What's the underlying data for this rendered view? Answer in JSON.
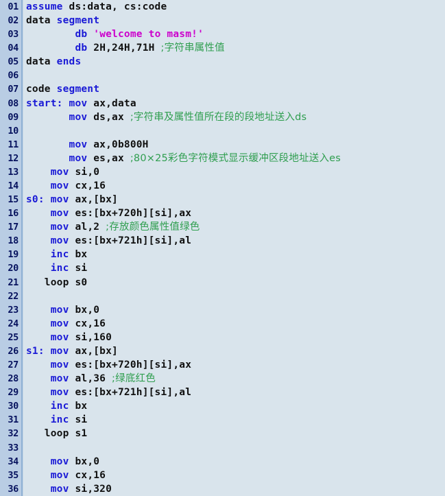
{
  "editor": {
    "name": "assembly-code-listing",
    "language": "masm-assembly",
    "background_color": "#d9e4ec",
    "gutter_color": "#b9cde4",
    "gutter_text_color": "#06125e",
    "keyword_color": "#1a1ad6",
    "text_color": "#101010",
    "string_color": "#cc00cc",
    "comment_color": "#2f9e4f",
    "first_line": 1,
    "last_line": 36,
    "total_lines": 36
  },
  "lines": [
    {
      "n": "01",
      "tokens": [
        {
          "c": "kw",
          "t": "assume"
        },
        {
          "c": "txt",
          "t": " ds:data, cs:code"
        }
      ]
    },
    {
      "n": "02",
      "tokens": [
        {
          "c": "txt",
          "t": "data "
        },
        {
          "c": "kw",
          "t": "segment"
        }
      ]
    },
    {
      "n": "03",
      "tokens": [
        {
          "c": "txt",
          "t": "        "
        },
        {
          "c": "kw",
          "t": "db"
        },
        {
          "c": "txt",
          "t": " "
        },
        {
          "c": "str",
          "t": "'welcome to masm!'"
        }
      ]
    },
    {
      "n": "04",
      "tokens": [
        {
          "c": "txt",
          "t": "        "
        },
        {
          "c": "kw",
          "t": "db"
        },
        {
          "c": "txt",
          "t": " 2H,24H,71H "
        },
        {
          "c": "cmt",
          "t": ";字符串属性值"
        }
      ]
    },
    {
      "n": "05",
      "tokens": [
        {
          "c": "txt",
          "t": "data "
        },
        {
          "c": "kw",
          "t": "ends"
        }
      ]
    },
    {
      "n": "06",
      "tokens": []
    },
    {
      "n": "07",
      "tokens": [
        {
          "c": "txt",
          "t": "code "
        },
        {
          "c": "kw",
          "t": "segment"
        }
      ]
    },
    {
      "n": "08",
      "tokens": [
        {
          "c": "kw",
          "t": "start:"
        },
        {
          "c": "txt",
          "t": " "
        },
        {
          "c": "kw",
          "t": "mov"
        },
        {
          "c": "txt",
          "t": " ax,data"
        }
      ]
    },
    {
      "n": "09",
      "tokens": [
        {
          "c": "txt",
          "t": "       "
        },
        {
          "c": "kw",
          "t": "mov"
        },
        {
          "c": "txt",
          "t": " ds,ax "
        },
        {
          "c": "cmt",
          "t": ";字符串及属性值所在段的段地址送入ds"
        }
      ]
    },
    {
      "n": "10",
      "tokens": []
    },
    {
      "n": "11",
      "tokens": [
        {
          "c": "txt",
          "t": "       "
        },
        {
          "c": "kw",
          "t": "mov"
        },
        {
          "c": "txt",
          "t": " ax,0b800H"
        }
      ]
    },
    {
      "n": "12",
      "tokens": [
        {
          "c": "txt",
          "t": "       "
        },
        {
          "c": "kw",
          "t": "mov"
        },
        {
          "c": "txt",
          "t": " es,ax "
        },
        {
          "c": "cmt",
          "t": ";80×25彩色字符模式显示缓冲区段地址送入es"
        }
      ]
    },
    {
      "n": "13",
      "tokens": [
        {
          "c": "txt",
          "t": "    "
        },
        {
          "c": "kw",
          "t": "mov"
        },
        {
          "c": "txt",
          "t": " si,0"
        }
      ]
    },
    {
      "n": "14",
      "tokens": [
        {
          "c": "txt",
          "t": "    "
        },
        {
          "c": "kw",
          "t": "mov"
        },
        {
          "c": "txt",
          "t": " cx,16"
        }
      ]
    },
    {
      "n": "15",
      "tokens": [
        {
          "c": "kw",
          "t": "s0:"
        },
        {
          "c": "txt",
          "t": " "
        },
        {
          "c": "kw",
          "t": "mov"
        },
        {
          "c": "txt",
          "t": " ax,[bx]"
        }
      ]
    },
    {
      "n": "16",
      "tokens": [
        {
          "c": "txt",
          "t": "    "
        },
        {
          "c": "kw",
          "t": "mov"
        },
        {
          "c": "txt",
          "t": " es:[bx+720h][si],ax"
        }
      ]
    },
    {
      "n": "17",
      "tokens": [
        {
          "c": "txt",
          "t": "    "
        },
        {
          "c": "kw",
          "t": "mov"
        },
        {
          "c": "txt",
          "t": " al,2 "
        },
        {
          "c": "cmt",
          "t": ";存放颜色属性值绿色"
        }
      ]
    },
    {
      "n": "18",
      "tokens": [
        {
          "c": "txt",
          "t": "    "
        },
        {
          "c": "kw",
          "t": "mov"
        },
        {
          "c": "txt",
          "t": " es:[bx+721h][si],al"
        }
      ]
    },
    {
      "n": "19",
      "tokens": [
        {
          "c": "txt",
          "t": "    "
        },
        {
          "c": "kw",
          "t": "inc"
        },
        {
          "c": "txt",
          "t": " bx"
        }
      ]
    },
    {
      "n": "20",
      "tokens": [
        {
          "c": "txt",
          "t": "    "
        },
        {
          "c": "kw",
          "t": "inc"
        },
        {
          "c": "txt",
          "t": " si"
        }
      ]
    },
    {
      "n": "21",
      "tokens": [
        {
          "c": "txt",
          "t": "   loop s0"
        }
      ]
    },
    {
      "n": "22",
      "tokens": []
    },
    {
      "n": "23",
      "tokens": [
        {
          "c": "txt",
          "t": "    "
        },
        {
          "c": "kw",
          "t": "mov"
        },
        {
          "c": "txt",
          "t": " bx,0"
        }
      ]
    },
    {
      "n": "24",
      "tokens": [
        {
          "c": "txt",
          "t": "    "
        },
        {
          "c": "kw",
          "t": "mov"
        },
        {
          "c": "txt",
          "t": " cx,16"
        }
      ]
    },
    {
      "n": "25",
      "tokens": [
        {
          "c": "txt",
          "t": "    "
        },
        {
          "c": "kw",
          "t": "mov"
        },
        {
          "c": "txt",
          "t": " si,160"
        }
      ]
    },
    {
      "n": "26",
      "tokens": [
        {
          "c": "kw",
          "t": "s1:"
        },
        {
          "c": "txt",
          "t": " "
        },
        {
          "c": "kw",
          "t": "mov"
        },
        {
          "c": "txt",
          "t": " ax,[bx]"
        }
      ]
    },
    {
      "n": "27",
      "tokens": [
        {
          "c": "txt",
          "t": "    "
        },
        {
          "c": "kw",
          "t": "mov"
        },
        {
          "c": "txt",
          "t": " es:[bx+720h][si],ax"
        }
      ]
    },
    {
      "n": "28",
      "tokens": [
        {
          "c": "txt",
          "t": "    "
        },
        {
          "c": "kw",
          "t": "mov"
        },
        {
          "c": "txt",
          "t": " al,36 "
        },
        {
          "c": "cmt",
          "t": ";绿底红色"
        }
      ]
    },
    {
      "n": "29",
      "tokens": [
        {
          "c": "txt",
          "t": "    "
        },
        {
          "c": "kw",
          "t": "mov"
        },
        {
          "c": "txt",
          "t": " es:[bx+721h][si],al"
        }
      ]
    },
    {
      "n": "30",
      "tokens": [
        {
          "c": "txt",
          "t": "    "
        },
        {
          "c": "kw",
          "t": "inc"
        },
        {
          "c": "txt",
          "t": " bx"
        }
      ]
    },
    {
      "n": "31",
      "tokens": [
        {
          "c": "txt",
          "t": "    "
        },
        {
          "c": "kw",
          "t": "inc"
        },
        {
          "c": "txt",
          "t": " si"
        }
      ]
    },
    {
      "n": "32",
      "tokens": [
        {
          "c": "txt",
          "t": "   loop s1"
        }
      ]
    },
    {
      "n": "33",
      "tokens": []
    },
    {
      "n": "34",
      "tokens": [
        {
          "c": "txt",
          "t": "    "
        },
        {
          "c": "kw",
          "t": "mov"
        },
        {
          "c": "txt",
          "t": " bx,0"
        }
      ]
    },
    {
      "n": "35",
      "tokens": [
        {
          "c": "txt",
          "t": "    "
        },
        {
          "c": "kw",
          "t": "mov"
        },
        {
          "c": "txt",
          "t": " cx,16"
        }
      ]
    },
    {
      "n": "36",
      "tokens": [
        {
          "c": "txt",
          "t": "    "
        },
        {
          "c": "kw",
          "t": "mov"
        },
        {
          "c": "txt",
          "t": " si,320"
        }
      ]
    }
  ]
}
